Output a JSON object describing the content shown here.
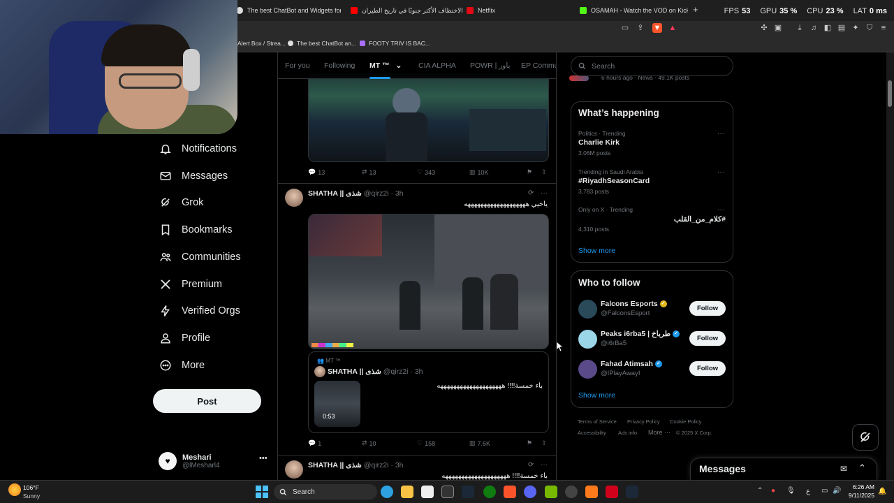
{
  "browser": {
    "tabs": [
      {
        "title": "The best ChatBot and Widgets for Ki",
        "color": "#dddddd"
      },
      {
        "title": "الاختطاف الأكثر جنونًا في تاريخ الطيران",
        "color": "#ff0000"
      },
      {
        "title": "Netflix",
        "color": "#e50914"
      },
      {
        "title": "OSAMAH - Watch the VOD on Kick",
        "color": "#53fc18"
      }
    ],
    "new_tab": "+",
    "perf": {
      "fps_label": "FPS",
      "fps": "53",
      "gpu_label": "GPU",
      "gpu": "35 %",
      "cpu_label": "CPU",
      "cpu": "23 %",
      "lat_label": "LAT",
      "lat": "0 ms"
    },
    "bookmarks": [
      {
        "title": "Alert Box / Strea...",
        "color": "#ff6a00"
      },
      {
        "title": "The best ChatBot an...",
        "color": "#dddddd"
      },
      {
        "title": "FOOTY TRIV IS BAC...",
        "color": "#a970ff"
      }
    ]
  },
  "nav": {
    "items": [
      {
        "label": "Notifications",
        "icon": "bell-icon"
      },
      {
        "label": "Messages",
        "icon": "envelope-icon"
      },
      {
        "label": "Grok",
        "icon": "grok-icon"
      },
      {
        "label": "Bookmarks",
        "icon": "bookmark-icon"
      },
      {
        "label": "Communities",
        "icon": "people-icon"
      },
      {
        "label": "Premium",
        "icon": "x-logo-icon"
      },
      {
        "label": "Verified Orgs",
        "icon": "lightning-icon"
      },
      {
        "label": "Profile",
        "icon": "person-icon"
      },
      {
        "label": "More",
        "icon": "more-circle-icon"
      }
    ],
    "post_button": "Post",
    "account": {
      "name": "Meshari",
      "handle": "@lMesharl4",
      "more": "•••"
    }
  },
  "timeline": {
    "tabs": [
      {
        "label": "For you"
      },
      {
        "label": "Following"
      },
      {
        "label": "MT ™"
      },
      {
        "label": "CIA ALPHA"
      },
      {
        "label": "POWR | باور"
      },
      {
        "label": "EP Commu"
      }
    ],
    "post1_actions": {
      "replies": "13",
      "reposts": "13",
      "likes": "343",
      "views": "10K"
    },
    "post2": {
      "name": "SHATHA || شذى",
      "handle": "@qirz2i · 3h",
      "text": "ياخيي هههههههههههههههههههه",
      "quote": {
        "community": "MT ™",
        "name": "SHATHA || شذى",
        "handle": "@qirz2i · 3h",
        "text": "باء خمسة!!!! ههههههههههههههههههههه",
        "duration": "0:53"
      },
      "actions": {
        "replies": "1",
        "reposts": "10",
        "likes": "158",
        "views": "7.6K"
      }
    },
    "post3": {
      "name": "SHATHA || شذى",
      "handle": "@qirz2i · 3h",
      "text": "باء خمسة!!!! ههههههههههههههههههههه"
    }
  },
  "right": {
    "search_placeholder": "Search",
    "news_meta": "6 hours ago · News · 49.1K posts",
    "happening": {
      "title": "What’s happening",
      "trends": [
        {
          "meta": "Politics · Trending",
          "name": "Charlie Kirk",
          "count": "3.06M posts"
        },
        {
          "meta": "Trending in Saudi Arabia",
          "name": "#RiyadhSeasonCard",
          "count": "3,783 posts"
        },
        {
          "meta": "Only on X · Trending",
          "name": "#كلام_من_القلب",
          "count": "4,310 posts"
        }
      ],
      "show_more": "Show more"
    },
    "who_to_follow": {
      "title": "Who to follow",
      "accounts": [
        {
          "name": "Falcons Esports",
          "handle": "@FalconsEsport",
          "button": "Follow",
          "color": "#2a4a5a"
        },
        {
          "name": "Peaks i6rba5 | طرباخ",
          "handle": "@i6rBa5",
          "button": "Follow",
          "color": "#9ad6e8"
        },
        {
          "name": "Fahad Atimsah",
          "handle": "@IPlayAwayI",
          "button": "Follow",
          "color": "#5a4a8a"
        }
      ],
      "show_more": "Show more"
    },
    "footer": {
      "terms": "Terms of Service",
      "privacy": "Privacy Policy",
      "cookie": "Cookie Policy",
      "access": "Accessibility",
      "ads": "Ads info",
      "more": "More ···",
      "copy": "© 2025 X Corp."
    },
    "messages_drawer": "Messages"
  },
  "taskbar": {
    "weather_temp": "106°F",
    "weather_desc": "Sunny",
    "search": "Search",
    "lang": "ع",
    "time": "6:26 AM",
    "date": "9/11/2025"
  }
}
